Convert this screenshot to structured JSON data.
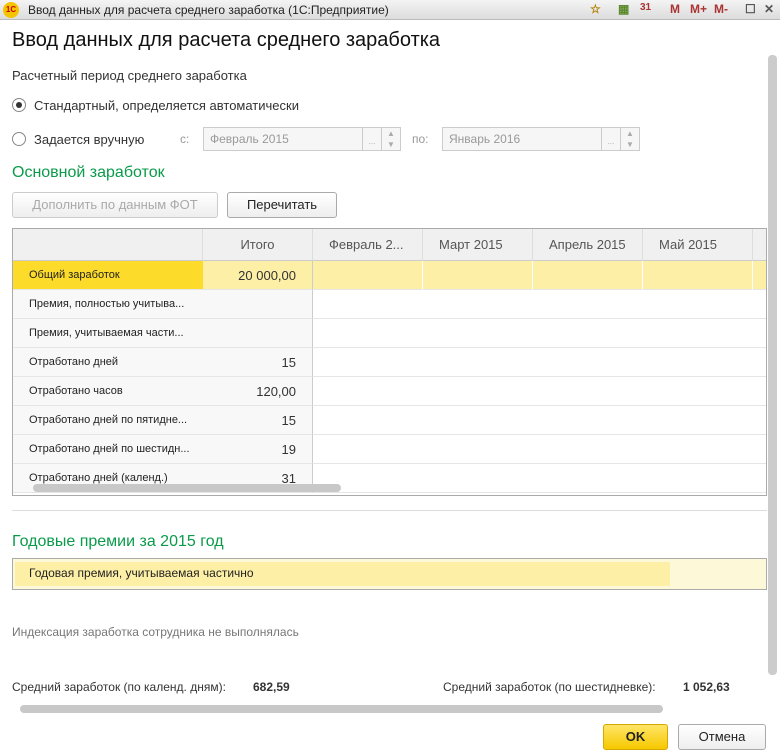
{
  "window": {
    "title": "Ввод данных для расчета среднего заработка  (1С:Предприятие)",
    "logo": "1С",
    "tools": [
      "star-icon",
      "calculator-icon",
      "calendar-icon"
    ],
    "calendar_num": "31",
    "m": "M",
    "mplus": "M+",
    "mminus": "M-"
  },
  "form": {
    "title": "Ввод данных для расчета среднего заработка",
    "period_label": "Расчетный период среднего заработка",
    "radio_auto": "Стандартный, определяется автоматически",
    "radio_manual": "Задается вручную",
    "radio_selected": "auto",
    "from_label": "с:",
    "from_value": "Февраль 2015",
    "to_label": "по:",
    "to_value": "Январь 2016",
    "ellipsis": "...",
    "main_section": "Основной заработок",
    "btn_fill": "Дополнить по данным ФОТ",
    "btn_reread": "Перечитать",
    "columns": [
      "",
      "Итого",
      "Февраль 2...",
      "Март 2015",
      "Апрель 2015",
      "Май 2015"
    ],
    "rows": [
      {
        "name": "Общий заработок",
        "total": "20 000,00"
      },
      {
        "name": "Премия, полностью учитыва...",
        "total": ""
      },
      {
        "name": "Премия, учитываемая части...",
        "total": ""
      },
      {
        "name": "Отработано дней",
        "total": "15"
      },
      {
        "name": "Отработано часов",
        "total": "120,00"
      },
      {
        "name": "Отработано дней по пятидне...",
        "total": "15"
      },
      {
        "name": "Отработано дней по шестидн...",
        "total": "19"
      },
      {
        "name": "Отработано дней (календ.)",
        "total": "31"
      }
    ],
    "annual_section": "Годовые премии за 2015 год",
    "annual_row": "Годовая премия, учитываемая частично",
    "indexation": "Индексация заработка сотрудника не выполнялась",
    "avg_cal_label": "Средний заработок (по календ. дням):",
    "avg_cal_value": "682,59",
    "avg_six_label": "Средний заработок (по шестидневке):",
    "avg_six_value": "1 052,63",
    "ok": "OK",
    "cancel": "Отмена"
  },
  "colors": {
    "accent_green": "#0a9b4a",
    "selected_yellow": "#fcdb2a",
    "row_yellow": "#fdf0a6"
  }
}
